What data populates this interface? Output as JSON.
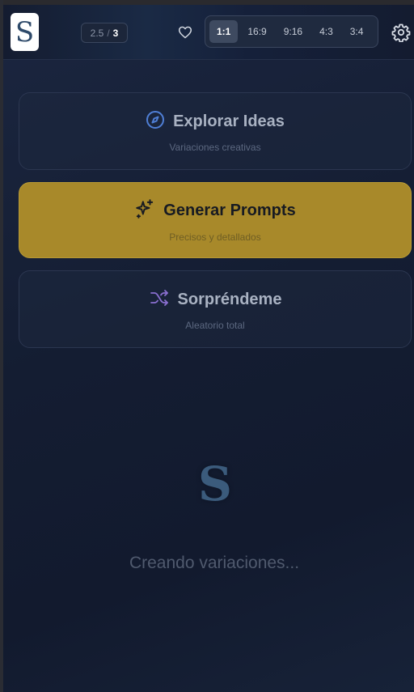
{
  "header": {
    "logo_letter": "S",
    "counter": {
      "used": "2.5",
      "separator": "/",
      "total": "3"
    },
    "aspect_ratios": [
      "1:1",
      "16:9",
      "9:16",
      "4:3",
      "3:4"
    ],
    "selected_ratio": "1:1"
  },
  "modes": [
    {
      "title": "Explorar Ideas",
      "subtitle": "Variaciones creativas",
      "icon": "compass-icon",
      "accent": "#4f7fd6"
    },
    {
      "title": "Generar Prompts",
      "subtitle": "Precisos y detallados",
      "icon": "sparkles-icon",
      "accent": "#a8892a"
    },
    {
      "title": "Sorpréndeme",
      "subtitle": "Aleatorio total",
      "icon": "shuffle-icon",
      "accent": "#8a6fd0"
    }
  ],
  "loader": {
    "logo_letter": "S",
    "text": "Creando variaciones..."
  }
}
